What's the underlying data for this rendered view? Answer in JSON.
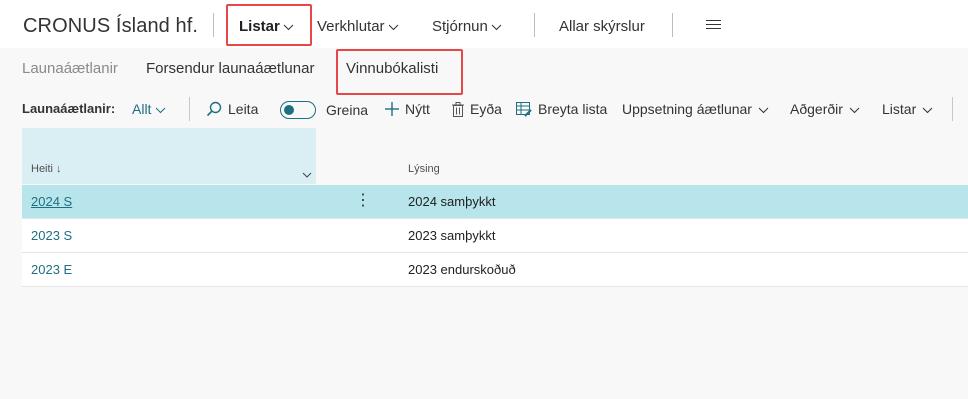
{
  "app": {
    "company": "CRONUS Ísland hf."
  },
  "topnav": {
    "items": [
      {
        "label": "Listar",
        "active": true
      },
      {
        "label": "Verkhlutar"
      },
      {
        "label": "Stjórnun"
      },
      {
        "label": "Allar skýrslur"
      }
    ]
  },
  "subnav": {
    "items": [
      {
        "label": "Launaáætlanir"
      },
      {
        "label": "Forsendur launaáætlunar"
      },
      {
        "label": "Vinnubókalisti"
      }
    ]
  },
  "actionbar": {
    "page_label": "Launaáætlanir:",
    "filter_value": "Allt",
    "search": "Leita",
    "analyze": "Greina",
    "new": "Nýtt",
    "delete": "Eyða",
    "edit_list": "Breyta lista",
    "setup": "Uppsetning áætlunar",
    "actions": "Aðgerðir",
    "lists": "Listar"
  },
  "grid": {
    "columns": [
      "Heiti ↓",
      "Lýsing"
    ],
    "rows": [
      {
        "code": "2024 S",
        "description": "2024 samþykkt"
      },
      {
        "code": "2023 S",
        "description": "2023 samþykkt"
      },
      {
        "code": "2023 E",
        "description": "2023 endurskoðuð"
      }
    ],
    "selected_index": 0
  },
  "colors": {
    "accent": "#1f6f82",
    "highlight": "#e8474a",
    "selected_row": "#b8e5eb"
  }
}
